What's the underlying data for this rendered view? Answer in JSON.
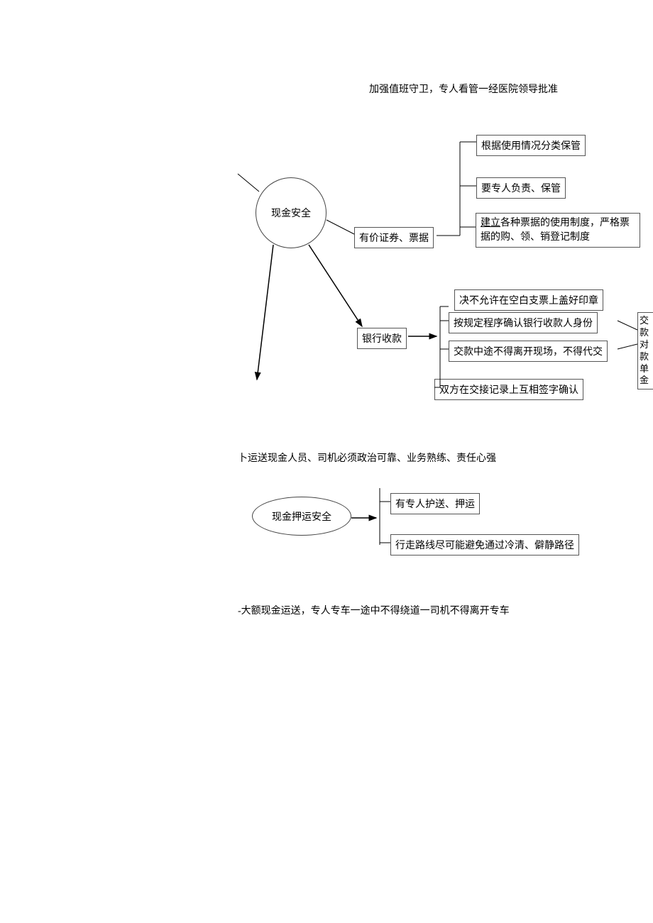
{
  "diagram1": {
    "top_text": "加强值班守卫，专人看管一经医院领导批准",
    "center_node": "现金安全",
    "branch_a": {
      "label": "有价证券、票据",
      "items": [
        "根据使用情况分类保管",
        "要专人负责、保管",
        "建立各种票据的使用制度，严格票据的购、领、销登记制度"
      ]
    },
    "branch_b": {
      "label": "银行收款",
      "items": [
        "决不允许在空白支票上盖好印章",
        "按规定程序确认银行收款人身份",
        "交款中途不得离开现场，不得代交",
        "双方在交接记录上互相签字确认"
      ],
      "side_note": "交款对款单金"
    }
  },
  "diagram2": {
    "top_text": "卜运送现金人员、司机必须政治可靠、业务熟练、责任心强",
    "center_node": "现金押运安全",
    "items": [
      "有专人护送、押运",
      "行走路线尽可能避免通过冷清、僻静路径"
    ],
    "bottom_text": "-大额现金运送，专人专车一途中不得绕道一司机不得离开专车"
  }
}
